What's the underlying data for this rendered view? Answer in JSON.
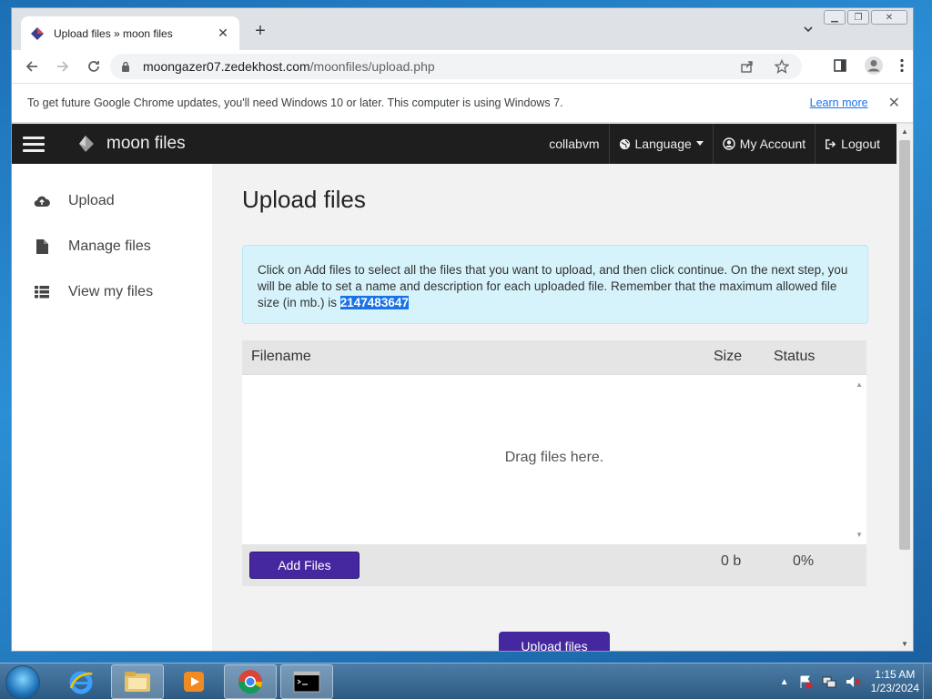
{
  "browser": {
    "tab_title": "Upload files » moon files",
    "url_host": "moongazer07.zedekhost.com",
    "url_path": "/moonfiles/upload.php",
    "infobar_text": "To get future Google Chrome updates, you'll need Windows 10 or later. This computer is using Windows 7.",
    "infobar_link": "Learn more"
  },
  "site": {
    "brand": "moon files",
    "nav": {
      "user": "collabvm",
      "language": "Language",
      "account": "My Account",
      "logout": "Logout"
    },
    "sidebar": [
      {
        "label": "Upload",
        "icon": "cloud-upload-icon"
      },
      {
        "label": "Manage files",
        "icon": "file-icon"
      },
      {
        "label": "View my files",
        "icon": "list-icon"
      }
    ]
  },
  "page": {
    "title": "Upload files",
    "alert_text": "Click on Add files to select all the files that you want to upload, and then click continue. On the next step, you will be able to set a name and description for each uploaded file. Remember that the maximum allowed file size (in mb.) is ",
    "alert_highlight": "2147483647",
    "uploader": {
      "col_filename": "Filename",
      "col_size": "Size",
      "col_status": "Status",
      "drag_text": "Drag files here.",
      "add_button": "Add Files",
      "total_size": "0 b",
      "total_status": "0%"
    },
    "upload_button": "Upload files"
  },
  "taskbar": {
    "time": "1:15 AM",
    "date": "1/23/2024",
    "apps": [
      "internet-explorer-icon",
      "explorer-folder-icon",
      "media-player-icon",
      "chrome-icon",
      "cmd-icon"
    ]
  },
  "colors": {
    "accent": "#4527a0",
    "navbar": "#1e1e1e",
    "alert_bg": "#d6f3fb",
    "highlight": "#1a73e8"
  }
}
